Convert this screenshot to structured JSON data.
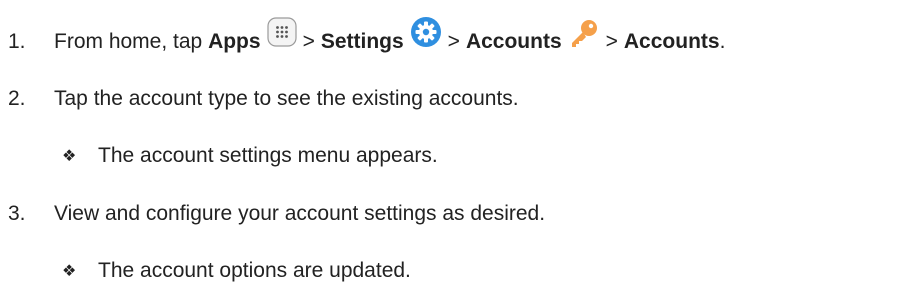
{
  "steps": [
    {
      "num": "1.",
      "parts": {
        "t1": "From home, tap ",
        "apps": "Apps",
        "gt1": ">",
        "settings": "Settings",
        "gt2": ">",
        "accounts1": "Accounts",
        "gt3": ">",
        "accounts2": "Accounts",
        "end": "."
      },
      "icons": [
        "apps-icon",
        "settings-gear-icon",
        "accounts-key-icon"
      ]
    },
    {
      "num": "2.",
      "text": "Tap the account type to see the existing accounts.",
      "sub": {
        "bullet": "❖",
        "text": "The account settings menu appears."
      }
    },
    {
      "num": "3.",
      "text": "View and configure your account settings as desired.",
      "sub": {
        "bullet": "❖",
        "text": "The account options are updated."
      }
    }
  ],
  "colors": {
    "text": "#222222",
    "settings_icon": "#2f8fe0",
    "key_icon": "#f5a04a",
    "apps_icon_border": "#9a9a9a"
  }
}
